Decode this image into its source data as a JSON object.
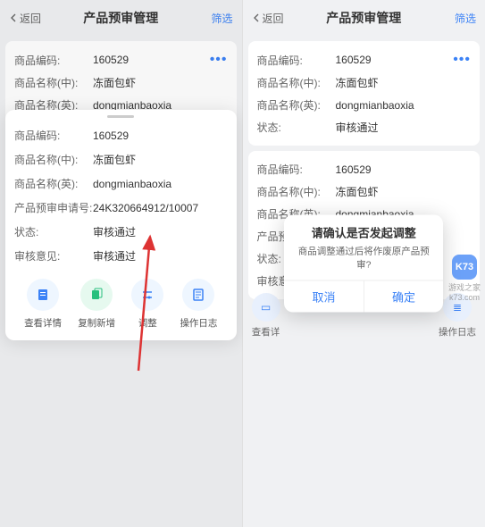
{
  "header": {
    "back": "返回",
    "title": "产品预审管理",
    "filter": "筛选"
  },
  "card1": {
    "code_l": "商品编码:",
    "code_v": "160529",
    "name_cn_l": "商品名称(中):",
    "name_cn_v": "冻面包虾",
    "name_en_l": "商品名称(英):",
    "name_en_v": "dongmianbaoxia",
    "status_l": "状态:",
    "status_v": "审核通过"
  },
  "sheet": {
    "d_code_l": "商品编码:",
    "d_code_v": "160529",
    "d_name_cn_l": "商品名称(中):",
    "d_name_cn_v": "冻面包虾",
    "d_name_en_l": "商品名称(英):",
    "d_name_en_v": "dongmianbaoxia",
    "apply_l": "产品预审申请号:",
    "apply_v": "24K320664912/10007",
    "status_l": "状态:",
    "status_v": "审核通过",
    "opinion_l": "审核意见:",
    "opinion_v": "审核通过"
  },
  "actions": {
    "a1": "查看详情",
    "a2": "复制新增",
    "a3": "调整",
    "a4": "操作日志"
  },
  "dialog": {
    "title": "请确认是否发起调整",
    "msg": "商品调整通过后将作废原产品预审?",
    "cancel": "取消",
    "ok": "确定"
  },
  "watermark": {
    "logo": "K73",
    "sub": "游戏之家",
    "site": "k73.com"
  },
  "peek": {
    "p1": "查看详",
    "p2": "操作日志"
  },
  "more": "•••"
}
